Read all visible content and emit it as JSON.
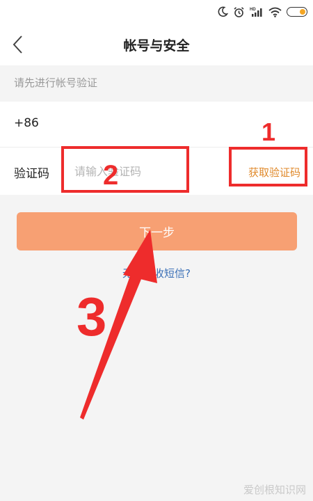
{
  "header": {
    "title": "帐号与安全"
  },
  "form": {
    "hint": "请先进行帐号验证",
    "country_code": "+86",
    "code_label": "验证码",
    "code_placeholder": "请输入验证码",
    "get_code_label": "获取验证码"
  },
  "actions": {
    "next_label": "下一步",
    "no_sms_label": "无法接收短信?"
  },
  "annotations": {
    "one": "1",
    "two": "2",
    "three": "3"
  },
  "watermark": "爱创根知识网",
  "colors": {
    "accent_orange": "#f7a073",
    "get_code_text": "#e08a2c",
    "link_blue": "#3a6fb6",
    "annotation_red": "#ee2c2c",
    "battery_fill": "#f5a623"
  },
  "icons": [
    "moon-icon",
    "alarm-icon",
    "signal-icon",
    "wifi-icon",
    "battery-icon",
    "back-chevron-icon"
  ]
}
